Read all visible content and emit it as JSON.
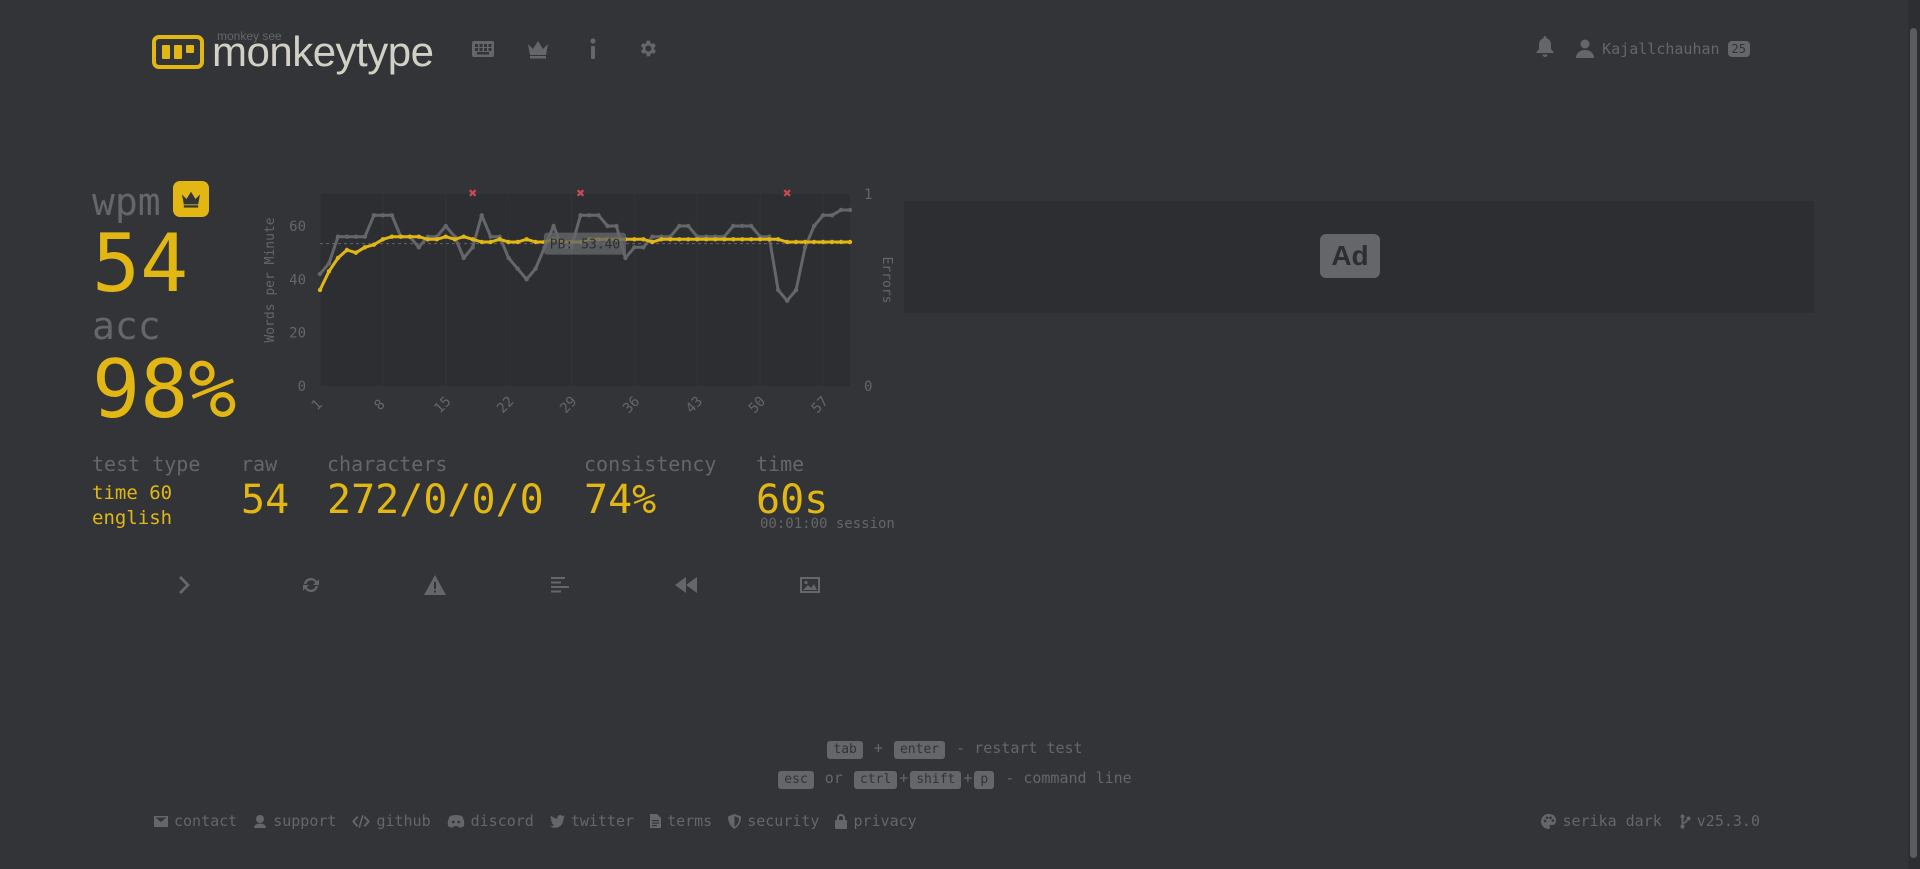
{
  "header": {
    "logo_sub": "monkey see",
    "logo_text": "monkeytype",
    "nav": [
      {
        "name": "keyboard-icon"
      },
      {
        "name": "crown-icon"
      },
      {
        "name": "info-icon"
      },
      {
        "name": "gear-icon"
      }
    ],
    "username": "Kajallchauhan",
    "level": "25"
  },
  "result": {
    "wpm_label": "wpm",
    "wpm": "54",
    "acc_label": "acc",
    "acc": "98%",
    "test_type_label": "test type",
    "test_type_line1": "time 60",
    "test_type_line2": "english",
    "raw_label": "raw",
    "raw": "54",
    "characters_label": "characters",
    "characters": "272/0/0/0",
    "consistency_label": "consistency",
    "consistency": "74%",
    "time_label": "time",
    "time": "60s",
    "session": "00:01:00 session"
  },
  "chart_data": {
    "type": "line",
    "ylabel": "Words per Minute",
    "y2label": "Errors",
    "ylim": [
      0,
      72
    ],
    "y_ticks": [
      "0",
      "20",
      "40",
      "60"
    ],
    "y2_ticks": [
      "0",
      "1"
    ],
    "x_ticks": [
      "1",
      "8",
      "15",
      "22",
      "29",
      "36",
      "43",
      "50",
      "57"
    ],
    "pb_label": "PB: 53.40",
    "pb_value": 53.4,
    "series": [
      {
        "name": "wpm",
        "color": "#e2b714",
        "values": [
          36,
          43,
          48,
          51,
          50,
          52,
          53,
          55,
          56,
          56,
          56,
          56,
          55,
          55,
          56,
          55,
          56,
          55,
          54,
          54,
          55,
          54,
          54,
          55,
          54,
          54,
          55,
          54,
          54,
          54,
          55,
          55,
          55,
          55,
          55,
          55,
          55,
          54,
          55,
          55,
          55,
          55,
          55,
          55,
          55,
          55,
          55,
          55,
          55,
          55,
          55,
          55,
          54,
          54,
          54,
          54,
          54,
          54,
          54,
          54
        ]
      },
      {
        "name": "raw",
        "color": "#646669",
        "values": [
          42,
          46,
          56,
          56,
          56,
          56,
          64,
          64,
          64,
          56,
          56,
          52,
          56,
          56,
          60,
          56,
          48,
          52,
          64,
          56,
          56,
          48,
          44,
          40,
          44,
          52,
          60,
          52,
          52,
          64,
          64,
          64,
          60,
          60,
          48,
          52,
          52,
          56,
          56,
          56,
          60,
          60,
          56,
          56,
          56,
          56,
          60,
          60,
          60,
          56,
          56,
          36,
          32,
          36,
          52,
          60,
          64,
          64,
          66,
          66
        ]
      }
    ],
    "error_x": [
      18,
      30,
      53
    ]
  },
  "actions": [
    {
      "name": "next-test-button"
    },
    {
      "name": "restart-test-button"
    },
    {
      "name": "practice-missed-button"
    },
    {
      "name": "words-history-button"
    },
    {
      "name": "watch-replay-button"
    },
    {
      "name": "save-screenshot-button"
    }
  ],
  "ad": {
    "label": "Ad"
  },
  "hints": {
    "tab": "tab",
    "plus": "+",
    "enter": "enter",
    "restart": "- restart test",
    "esc": "esc",
    "or": "or",
    "ctrl": "ctrl",
    "shift": "shift",
    "p": "p",
    "command": "- command line"
  },
  "footer": {
    "links": [
      "contact",
      "support",
      "github",
      "discord",
      "twitter",
      "terms",
      "security",
      "privacy"
    ],
    "theme": "serika dark",
    "version": "v25.3.0"
  },
  "colors": {
    "bg": "#323437",
    "main": "#e2b714",
    "sub": "#646669",
    "text": "#d1d0c5",
    "error": "#ca4754"
  }
}
